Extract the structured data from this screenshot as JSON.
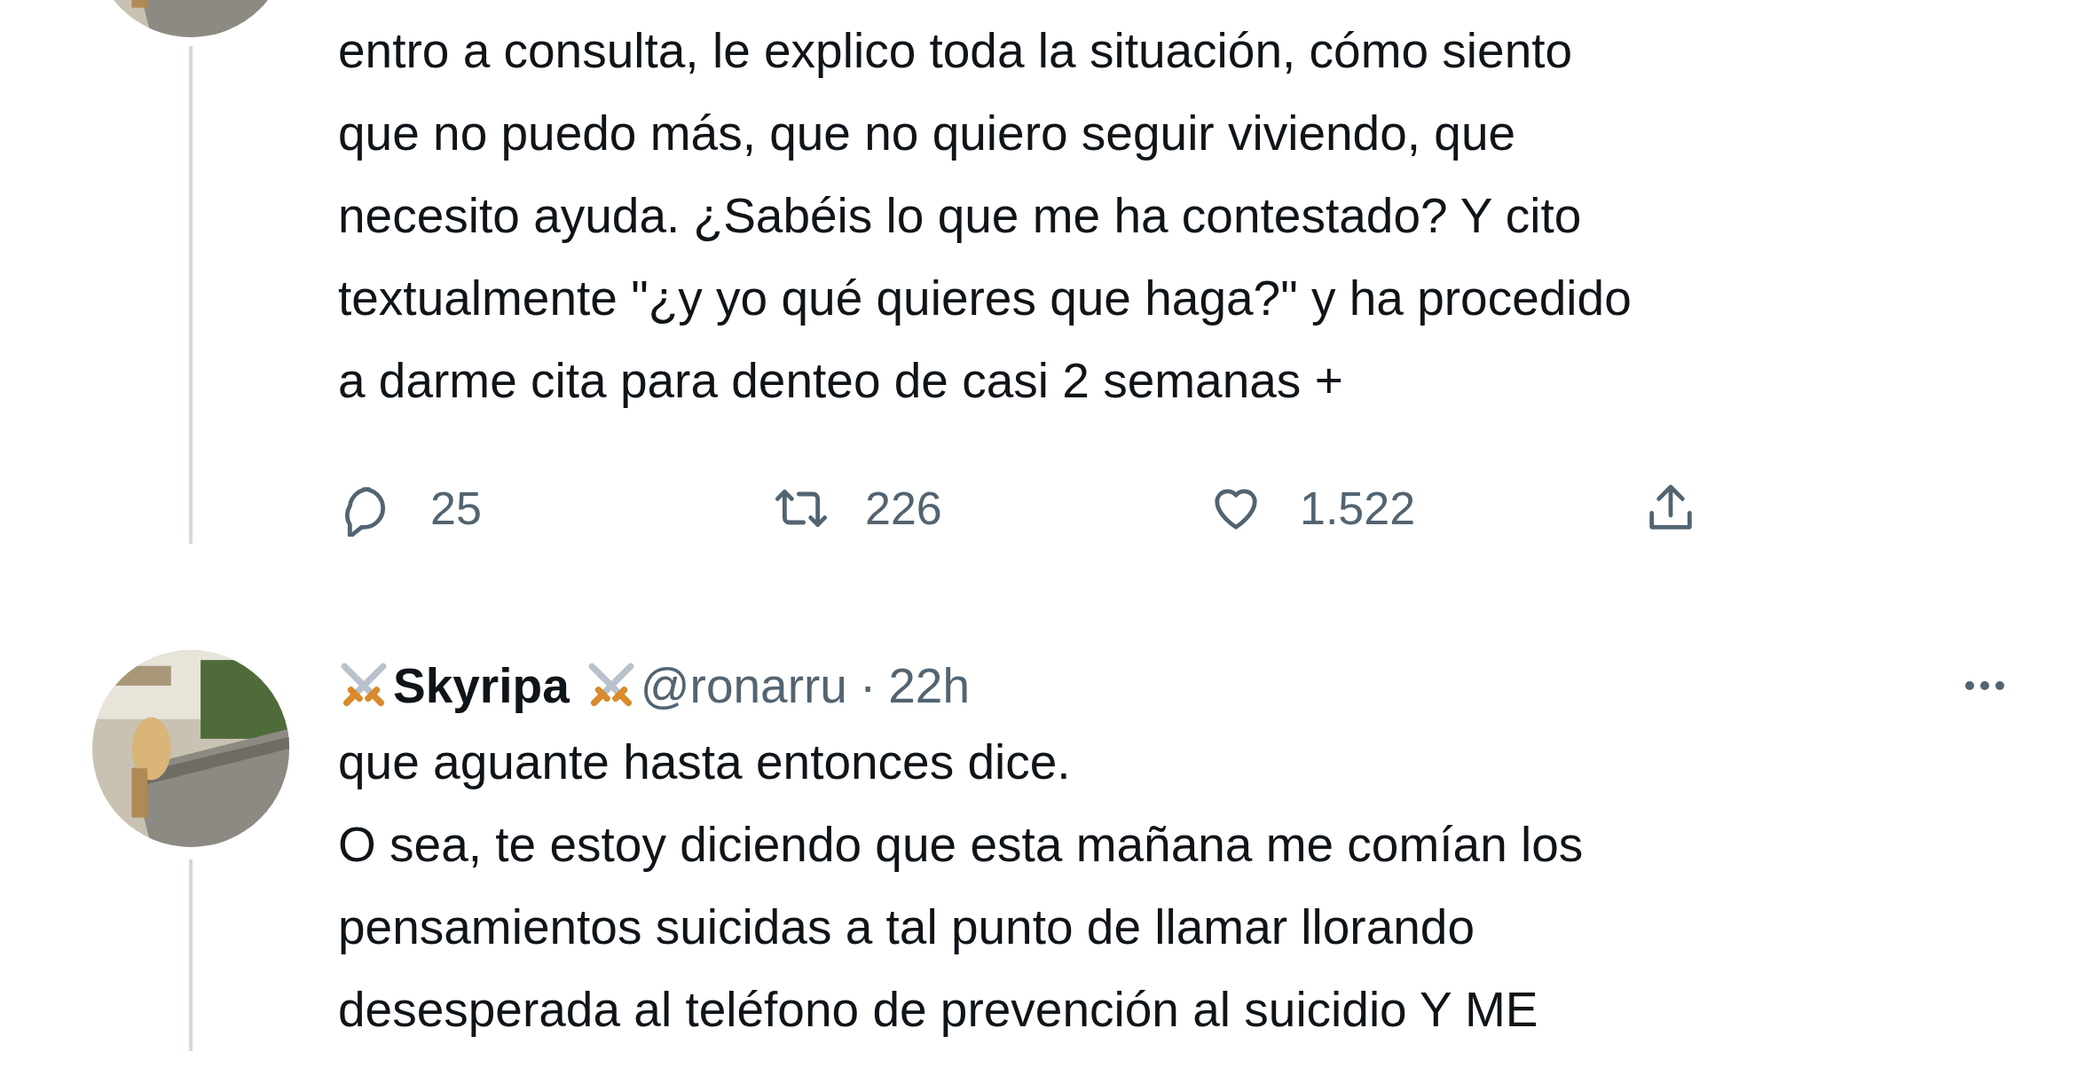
{
  "tweets": [
    {
      "text": "entro a consulta, le explico toda la situación, cómo siento\nque no puedo más, que no quiero seguir viviendo, que\nnecesito ayuda. ¿Sabéis lo que me ha contestado? Y cito\ntextualmente \"¿y yo qué quieres que haga?\" y ha procedido\na darme cita para denteo de casi 2 semanas +",
      "actions": [
        {
          "kind": "reply",
          "count": "25"
        },
        {
          "kind": "retweet",
          "count": "226"
        },
        {
          "kind": "like",
          "count": "1.522"
        },
        {
          "kind": "share"
        }
      ]
    },
    {
      "author": {
        "name": "Skyripa",
        "handle": "@ronarru",
        "separator": "·",
        "time": "22h"
      },
      "paragraphs": [
        "que aguante hasta entonces dice.",
        "O sea, te estoy diciendo que esta mañana me comían los\npensamientos suicidas a tal punto de llamar llorando\ndesesperada al teléfono de prevención al suicidio Y ME"
      ]
    }
  ]
}
